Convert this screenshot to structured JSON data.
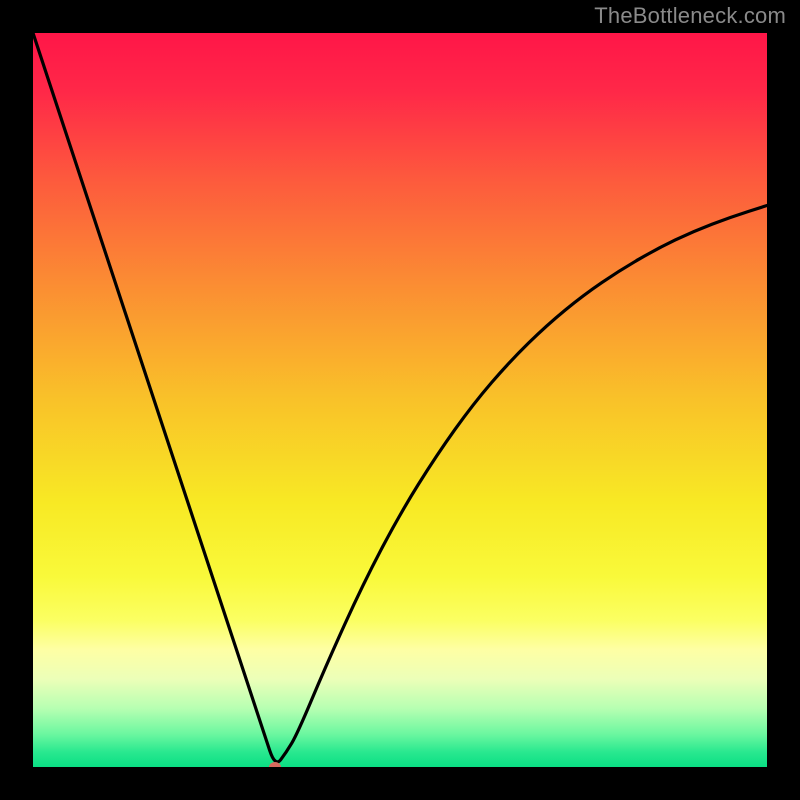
{
  "watermark": "TheBottleneck.com",
  "chart_data": {
    "type": "line",
    "title": "",
    "xlabel": "",
    "ylabel": "",
    "xlim": [
      0,
      100
    ],
    "ylim": [
      0,
      100
    ],
    "marker": {
      "x": 33,
      "y": 0,
      "color": "#d66a5e"
    },
    "series": [
      {
        "name": "curve",
        "x": [
          0,
          5,
          10,
          15,
          20,
          25,
          30,
          31.5,
          33,
          34.5,
          36,
          40,
          45,
          50,
          55,
          60,
          65,
          70,
          75,
          80,
          85,
          90,
          95,
          100
        ],
        "y": [
          100,
          84.8,
          69.7,
          54.5,
          39.4,
          24.2,
          9.1,
          4.5,
          0,
          2,
          4.5,
          14,
          25,
          34.5,
          42.5,
          49.5,
          55.3,
          60.2,
          64.3,
          67.7,
          70.6,
          73,
          74.9,
          76.5
        ]
      }
    ],
    "gradient_stops": [
      {
        "pos": 0.0,
        "color": "#ff1648"
      },
      {
        "pos": 0.08,
        "color": "#ff2848"
      },
      {
        "pos": 0.2,
        "color": "#fd5a3d"
      },
      {
        "pos": 0.34,
        "color": "#fb8c33"
      },
      {
        "pos": 0.5,
        "color": "#f9c229"
      },
      {
        "pos": 0.64,
        "color": "#f8e924"
      },
      {
        "pos": 0.74,
        "color": "#f9f93a"
      },
      {
        "pos": 0.8,
        "color": "#fbff62"
      },
      {
        "pos": 0.84,
        "color": "#feffa4"
      },
      {
        "pos": 0.88,
        "color": "#ecffb8"
      },
      {
        "pos": 0.92,
        "color": "#b7ffb2"
      },
      {
        "pos": 0.955,
        "color": "#6cf7a0"
      },
      {
        "pos": 0.98,
        "color": "#28e88f"
      },
      {
        "pos": 1.0,
        "color": "#0adf84"
      }
    ]
  }
}
